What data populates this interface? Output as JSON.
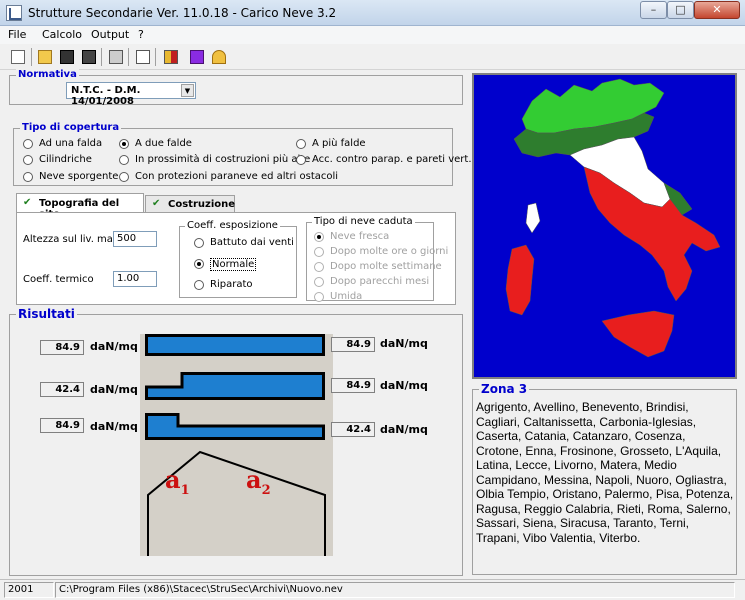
{
  "window": {
    "title": "Strutture Secondarie Ver. 11.0.18 - Carico Neve 3.2"
  },
  "menu": [
    "File",
    "Calcolo",
    "Output",
    "?"
  ],
  "toolbar": {
    "icons": [
      "new-document-icon",
      "open-folder-icon",
      "save-icon",
      "save-all-icon",
      "print-icon",
      "blank-page-icon",
      "export-icon",
      "book-icon",
      "help-icon"
    ]
  },
  "normativa": {
    "legend": "Normativa",
    "selected": "N.T.C. - D.M. 14/01/2008"
  },
  "copertura": {
    "legend": "Tipo di copertura",
    "options": [
      "Ad una falda",
      "A due falde",
      "A più falde",
      "Cilindriche",
      "In prossimità di costruzioni più alte",
      "Acc. contro parap. e pareti vert.",
      "Neve sporgente",
      "Con protezioni paraneve ed altri ostacoli"
    ],
    "selected": "A due falde"
  },
  "tabs": [
    "Topografia del sito",
    "Costruzione"
  ],
  "topografia": {
    "altezza_label": "Altezza sul liv. mare",
    "altezza_value": "500",
    "coeff_termico_label": "Coeff. termico",
    "coeff_termico_value": "1.00"
  },
  "esposizione": {
    "legend": "Coeff. esposizione",
    "options": [
      "Battuto dai venti",
      "Normale",
      "Riparato"
    ],
    "selected": "Normale"
  },
  "neve": {
    "legend": "Tipo di neve caduta",
    "options": [
      "Neve fresca",
      "Dopo molte ore o giorni",
      "Dopo molte settimane",
      "Dopo parecchi mesi",
      "Umida"
    ],
    "selected": "Neve fresca"
  },
  "risultati": {
    "legend": "Risultati",
    "unit": "daN/mq",
    "rows": [
      {
        "left": "84.9",
        "right": "84.9"
      },
      {
        "left": "42.4",
        "right": "84.9"
      },
      {
        "left": "84.9",
        "right": "42.4"
      }
    ],
    "a1": "a",
    "a1_sub": "1",
    "a2": "a",
    "a2_sub": "2"
  },
  "zona": {
    "title": "Zona 3",
    "text": "Agrigento, Avellino, Benevento, Brindisi, Cagliari, Caltanissetta, Carbonia-Iglesias, Caserta, Catania, Catanzaro, Cosenza, Crotone, Enna, Frosinone, Grosseto, L'Aquila, Latina, Lecce, Livorno, Matera, Medio Campidano, Messina, Napoli, Nuoro, Ogliastra, Olbia Tempio, Oristano, Palermo, Pisa, Potenza, Ragusa, Reggio Calabria, Rieti, Roma, Salerno, Sassari, Siena, Siracusa, Taranto, Terni, Trapani, Vibo Valentia, Viterbo."
  },
  "status": {
    "year": "2001",
    "path": "C:\\Program Files (x86)\\Stacec\\StruSec\\Archivi\\Nuovo.nev"
  },
  "colors": {
    "zone1": "#33cc33",
    "zone2": "#2e7d2e",
    "zone3": "#e81e1e",
    "map_bg": "#0000cc",
    "bar": "#1e7fd0",
    "legend_text": "#0000cc"
  }
}
